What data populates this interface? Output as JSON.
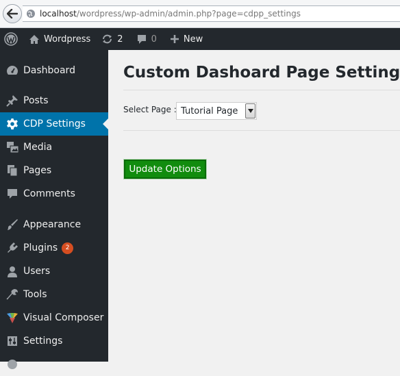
{
  "browser": {
    "url_host": "localhost",
    "url_path": "/wordpress/wp-admin/admin.php?page=cdpp_settings"
  },
  "adminbar": {
    "site_name": "Wordpress",
    "updates_count": "2",
    "comments_count": "0",
    "new_label": "New"
  },
  "sidebar": {
    "items": [
      {
        "label": "Dashboard",
        "icon": "dashboard-icon"
      },
      {
        "label": "Posts",
        "icon": "pushpin-icon"
      },
      {
        "label": "CDP Settings",
        "icon": "gear-icon"
      },
      {
        "label": "Media",
        "icon": "media-icon"
      },
      {
        "label": "Pages",
        "icon": "pages-icon"
      },
      {
        "label": "Comments",
        "icon": "comment-icon"
      },
      {
        "label": "Appearance",
        "icon": "brush-icon"
      },
      {
        "label": "Plugins",
        "icon": "plugin-icon",
        "badge": "2"
      },
      {
        "label": "Users",
        "icon": "user-icon"
      },
      {
        "label": "Tools",
        "icon": "wrench-icon"
      },
      {
        "label": "Visual Composer",
        "icon": "visual-composer-icon"
      },
      {
        "label": "Settings",
        "icon": "settings-sliders-icon"
      }
    ]
  },
  "main": {
    "title": "Custom Dashoard Page Settings",
    "select_label": "Select Page :",
    "select_value": "Tutorial Page",
    "update_button": "Update Options"
  },
  "colors": {
    "adminbar_bg": "#23282d",
    "current_item_bg": "#0073aa",
    "update_button_bg": "#118c0e",
    "badge_bg": "#d54e21"
  }
}
